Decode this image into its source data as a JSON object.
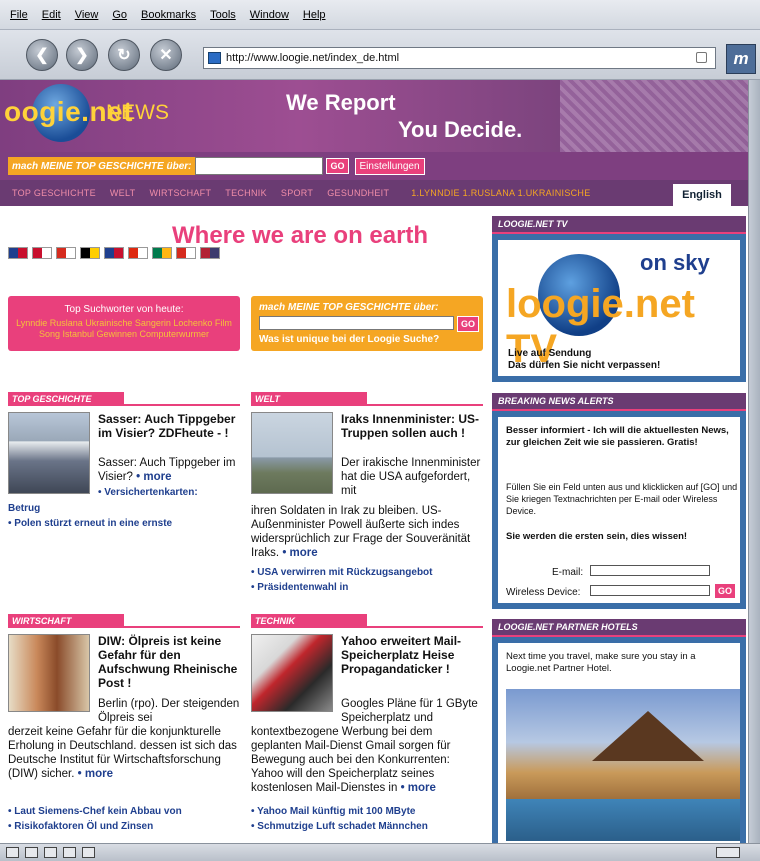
{
  "browser": {
    "menu": [
      "File",
      "Edit",
      "View",
      "Go",
      "Bookmarks",
      "Tools",
      "Window",
      "Help"
    ],
    "url": "http://www.loogie.net/index_de.html",
    "nav_glyphs": {
      "back": "❮",
      "forward": "❯",
      "reload": "↻",
      "stop": "✕"
    },
    "logo_glyph": "m"
  },
  "banner": {
    "logo_text": "oogie.net",
    "logo_news": "NEWS",
    "slogan_line1": "We Report",
    "slogan_line2": "You Decide."
  },
  "searchbar": {
    "label": "mach MEINE TOP GESCHICHTE über:",
    "go": "GO",
    "settings": "Einstellungen"
  },
  "nav": {
    "items": [
      "TOP GESCHICHTE",
      "WELT",
      "WIRTSCHAFT",
      "TECHNIK",
      "SPORT",
      "GESUNDHEIT"
    ],
    "hot": "1.LYNNDIE 1.RUSLANA 1.UKRAINISCHE",
    "english": "English"
  },
  "main": {
    "headline": "Where we are on earth",
    "flags": [
      {
        "name": "australia",
        "c1": "#1f3f8e",
        "c2": "#c8102e"
      },
      {
        "name": "austria",
        "c1": "#c8102e",
        "c2": "#ffffff"
      },
      {
        "name": "canada",
        "c1": "#d52b1e",
        "c2": "#ffffff"
      },
      {
        "name": "germany",
        "c1": "#000000",
        "c2": "#ffce00"
      },
      {
        "name": "uk",
        "c1": "#1f3f8e",
        "c2": "#c8102e"
      },
      {
        "name": "hong-kong",
        "c1": "#de2910",
        "c2": "#ffffff"
      },
      {
        "name": "south-africa",
        "c1": "#007a4d",
        "c2": "#ffb612"
      },
      {
        "name": "switzerland",
        "c1": "#d52b1e",
        "c2": "#ffffff"
      },
      {
        "name": "usa",
        "c1": "#b22234",
        "c2": "#3c3b6e"
      }
    ],
    "suchwoerter": {
      "title": "Top Suchworter von heute:",
      "terms": "Lynndie Ruslana Ukrainische Sangerin Lochenko Film Song Istanbul Gewinnen Computerwurmer"
    },
    "meine": {
      "label": "mach MEINE TOP GESCHICHTE über:",
      "go": "GO",
      "unique": "Was ist unique bei der Loogie Suche?"
    }
  },
  "articles": {
    "top": {
      "section": "TOP GESCHICHTE",
      "title": "Sasser: Auch Tippgeber im Visier? ZDFheute - !",
      "body": "Sasser: Auch Tippgeber im Visier?",
      "more": "• more",
      "link1": "• Versichertenkarten:",
      "link1b": "Betrug",
      "link2": "• Polen stürzt erneut in eine ernste"
    },
    "welt": {
      "section": "WELT",
      "title": "Iraks Innenminister: US-Truppen sollen auch !",
      "body1": "Der irakische Innenminister hat die USA aufgefordert, mit",
      "body2": "ihren Soldaten in Irak zu bleiben. US-Außenminister Powell äußerte sich indes widersprüchlich zur Frage der Souveränität Iraks.",
      "more": "• more",
      "link1": "• USA verwirren mit Rückzugsangebot",
      "link2": "• Präsidentenwahl in"
    },
    "wirtschaft": {
      "section": "WIRTSCHAFT",
      "title": "DIW: Ölpreis ist keine Gefahr für den Aufschwung Rheinische Post !",
      "body1": "Berlin (rpo). Der steigenden Ölpreis sei",
      "body2": "derzeit keine Gefahr für die konjunkturelle Erholung in Deutschland. dessen ist sich das Deutsche Institut für Wirtschaftsforschung (DIW) sicher.",
      "more": "• more",
      "link1": "• Laut Siemens-Chef kein Abbau von",
      "link2": "• Risikofaktoren Öl und Zinsen"
    },
    "technik": {
      "section": "TECHNIK",
      "title": "Yahoo erweitert Mail-Speicherplatz Heise Propagandaticker !",
      "body1": "Googles Pläne für 1 GByte Speicherplatz und",
      "body2": "kontextbezogene Werbung bei dem geplanten Mail-Dienst Gmail sorgen für Bewegung auch bei den Konkurrenten: Yahoo will den Speicherplatz seines kostenlosen Mail-Dienstes in",
      "more": "• more",
      "link1": "• Yahoo Mail künftig mit 100 MByte",
      "link2": "• Schmutzige Luft schadet Männchen"
    }
  },
  "sidebar": {
    "tv": {
      "header": "LOOGIE.NET TV",
      "on_sky": "on sky",
      "logo": "loogie.net TV",
      "live1": "Live auf Sendung",
      "live2": "Das dürfen Sie nicht verpassen!"
    },
    "breaking": {
      "header": "BREAKING NEWS ALERTS",
      "intro": "Besser informiert - Ich will die aktuellesten News, zur gleichen Zeit wie sie passieren.  Gratis!",
      "instructions": "Füllen Sie ein Feld unten aus und klicklicken auf [GO] und Sie kriegen Textnachrichten per E-mail oder Wireless Device.",
      "first": "Sie werden die ersten sein, dies wissen!",
      "email_label": "E-mail:",
      "wireless_label": "Wireless Device:",
      "go": "GO"
    },
    "hotels": {
      "header": "LOOGIE.NET PARTNER HOTELS",
      "text": "Next time you travel, make sure you stay in a Loogie.net Partner Hotel."
    }
  }
}
